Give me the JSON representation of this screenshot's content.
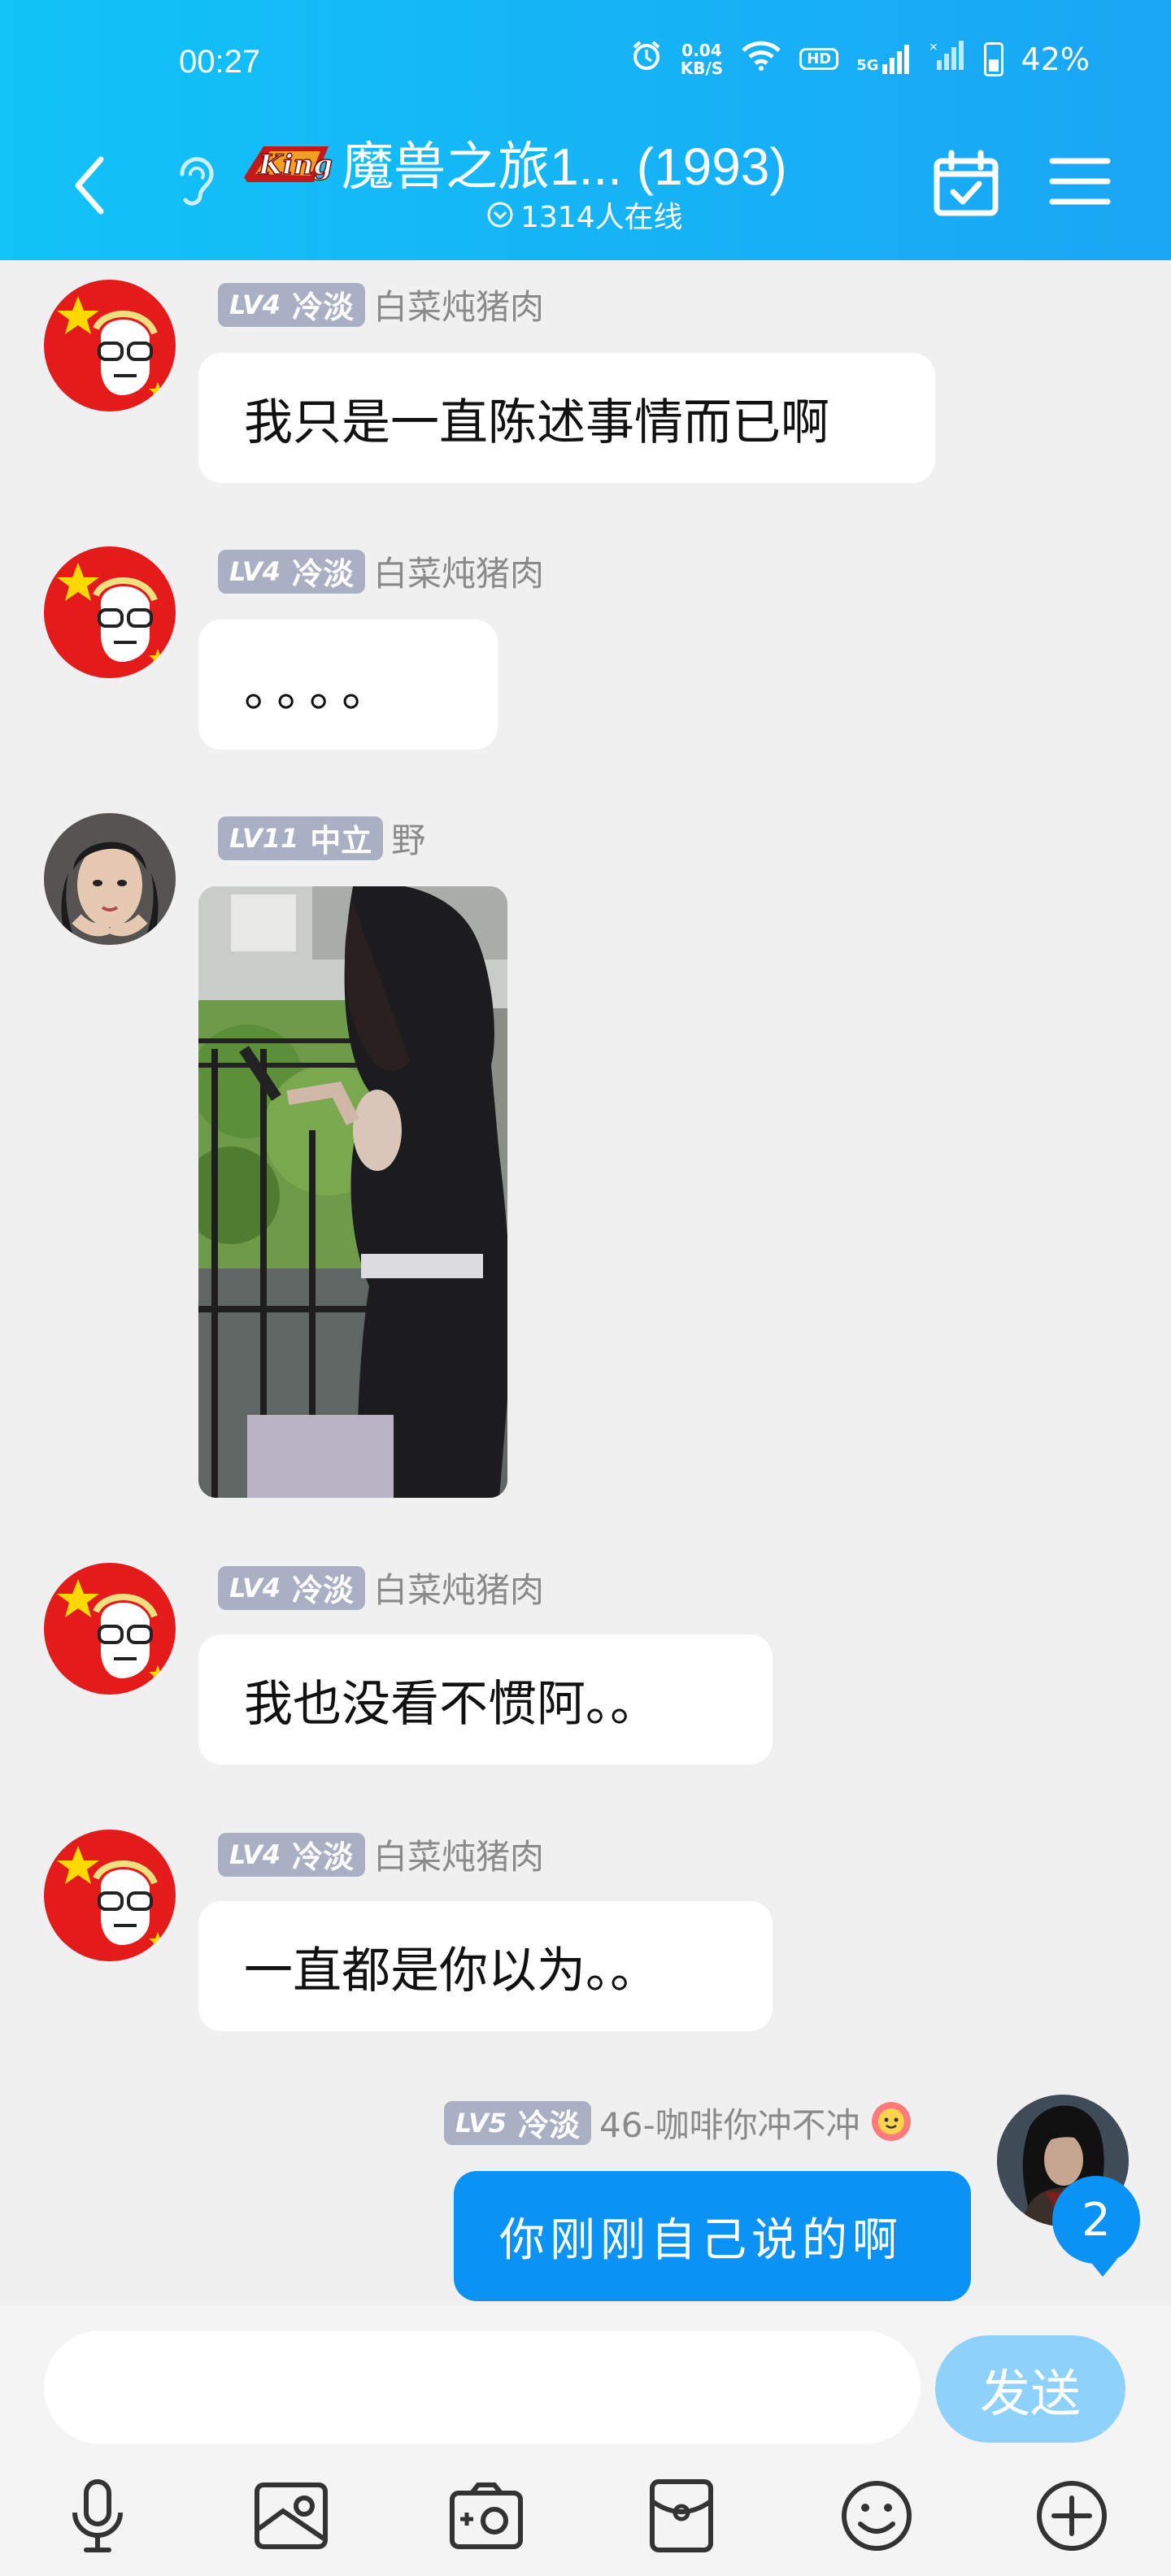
{
  "status_bar": {
    "time": "00:27",
    "net_speed_value": "0.04",
    "net_speed_unit": "KB/S",
    "hd_label": "HD",
    "signal_label": "5G",
    "battery": "42%"
  },
  "header": {
    "title": "魔兽之旅1... (1993)",
    "online": "1314人在线",
    "logo_text": "King"
  },
  "messages": [
    {
      "level": "LV4",
      "title": "冷淡",
      "nick": "白菜炖猪肉",
      "text": "我只是一直陈述事情而已啊"
    },
    {
      "level": "LV4",
      "title": "冷淡",
      "nick": "白菜炖猪肉",
      "text": "。。。。"
    },
    {
      "level": "LV11",
      "title": "中立",
      "nick": "野",
      "type": "image"
    },
    {
      "level": "LV4",
      "title": "冷淡",
      "nick": "白菜炖猪肉",
      "text": "我也没看不惯阿。。"
    },
    {
      "level": "LV4",
      "title": "冷淡",
      "nick": "白菜炖猪肉",
      "text": "一直都是你以为。。"
    },
    {
      "level": "LV5",
      "title": "冷淡",
      "nick": "46-咖啡你冲不冲",
      "text": "你刚刚自己说的啊",
      "self": true
    }
  ],
  "unread_count": "2",
  "input": {
    "send_label": "发送"
  },
  "toolbar": [
    "mic-icon",
    "picture-icon",
    "camera-icon",
    "red-packet-icon",
    "emoji-icon",
    "plus-icon"
  ],
  "colors": {
    "header": "#11c3f7",
    "accent": "#0a93f5",
    "send_disabled": "#8ed2fb",
    "level_badge": "#a9b0c3"
  }
}
